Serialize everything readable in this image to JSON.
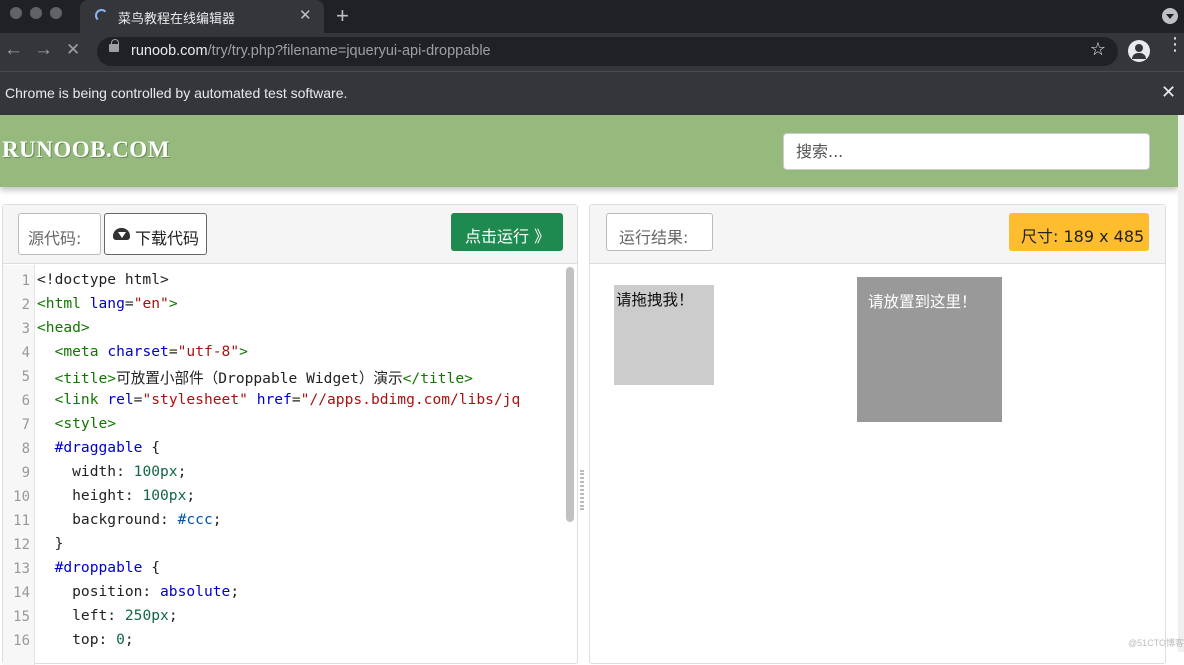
{
  "browser": {
    "tab_title": "菜鸟教程在线编辑器",
    "url_host": "runoob.com",
    "url_path": "/try/try.php?filename=jqueryui-api-droppable",
    "infobar_message": "Chrome is being controlled by automated test software.",
    "newtab_glyph": "+",
    "close_glyph": "✕",
    "star_glyph": "☆",
    "back_glyph": "←",
    "forward_glyph": "→",
    "stop_glyph": "✕",
    "kebab_glyph": "⋮"
  },
  "site": {
    "logo": "RUNOOB.COM",
    "search_placeholder": "搜索..."
  },
  "left_panel": {
    "source_label": "源代码:",
    "download_label": "下载代码",
    "run_label": "点击运行 》"
  },
  "right_panel": {
    "result_label": "运行结果:",
    "size_label": "尺寸: 189 x 485"
  },
  "editor": {
    "line_numbers": [
      "1",
      "2",
      "3",
      "4",
      "5",
      "6",
      "7",
      "8",
      "9",
      "10",
      "11",
      "12",
      "13",
      "14",
      "15",
      "16"
    ]
  },
  "result": {
    "draggable_text": "请拖拽我！",
    "droppable_text": "请放置到这里！"
  },
  "watermark": "@51CTO博客"
}
